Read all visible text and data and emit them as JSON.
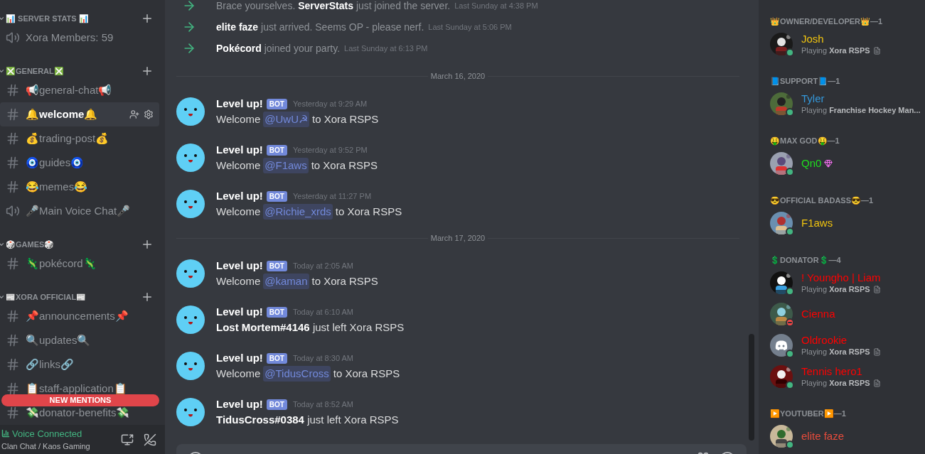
{
  "sidebar": {
    "categories": [
      {
        "name": "📊 SERVER STATS 📊",
        "channels": [
          {
            "kind": "voice",
            "name": "Xora Members: 59",
            "selected": false
          }
        ]
      },
      {
        "name": "❎GENERAL❎",
        "channels": [
          {
            "kind": "text",
            "name": "📢general-chat📢",
            "selected": false
          },
          {
            "kind": "text",
            "name": "🔔welcome🔔",
            "selected": true
          },
          {
            "kind": "text",
            "name": "💰trading-post💰",
            "selected": false
          },
          {
            "kind": "text",
            "name": "🧿guides🧿",
            "selected": false
          },
          {
            "kind": "text",
            "name": "😂memes😂",
            "selected": false
          },
          {
            "kind": "voice",
            "name": "🎤Main Voice Chat🎤",
            "selected": false
          }
        ]
      },
      {
        "name": "🎲GAMES🎲",
        "channels": [
          {
            "kind": "text",
            "name": "🦎pokécord🦎",
            "selected": false
          }
        ]
      },
      {
        "name": "📰XORA OFFICIAL📰",
        "channels": [
          {
            "kind": "text",
            "name": "📌announcements📌",
            "selected": false
          },
          {
            "kind": "text",
            "name": "🔍updates🔍",
            "selected": false
          },
          {
            "kind": "text",
            "name": "🔗links🔗",
            "selected": false
          },
          {
            "kind": "text",
            "name": "📋staff-application📋",
            "selected": false
          },
          {
            "kind": "text",
            "name": "💸donator-benefits💸",
            "selected": false
          }
        ]
      }
    ],
    "new_mentions": "NEW MENTIONS",
    "voice_panel": {
      "status": "Voice Connected",
      "channel": "Clan Chat / Kaos Gaming"
    }
  },
  "chat": {
    "items": [
      {
        "kind": "system",
        "text": "Brace yourselves. **ServerStats** just joined the server.",
        "time": "Last Sunday at 4:38 PM"
      },
      {
        "kind": "system",
        "text": "**elite faze** just arrived. Seems OP - please nerf.",
        "time": "Last Sunday at 5:06 PM"
      },
      {
        "kind": "system",
        "text": "**Pokécord** joined your party.",
        "time": "Last Sunday at 6:13 PM"
      },
      {
        "kind": "divider",
        "text": "March 16, 2020"
      },
      {
        "kind": "message",
        "author": "Level up!",
        "tag": "BOT",
        "time": "Yesterday at 9:29 AM",
        "before": "Welcome",
        "mention": "@UwU☭",
        "after": "to Xora RSPS"
      },
      {
        "kind": "message",
        "author": "Level up!",
        "tag": "BOT",
        "time": "Yesterday at 9:52 PM",
        "before": "Welcome",
        "mention": "@F1aws",
        "after": "to Xora RSPS"
      },
      {
        "kind": "message",
        "author": "Level up!",
        "tag": "BOT",
        "time": "Yesterday at 11:27 PM",
        "before": "Welcome",
        "mention": "@Richie_xrds",
        "after": "to Xora RSPS"
      },
      {
        "kind": "divider",
        "text": "March 17, 2020"
      },
      {
        "kind": "message",
        "author": "Level up!",
        "tag": "BOT",
        "time": "Today at 2:05 AM",
        "before": "Welcome",
        "mention": "@kaman",
        "after": "to Xora RSPS"
      },
      {
        "kind": "message",
        "author": "Level up!",
        "tag": "BOT",
        "time": "Today at 6:10 AM",
        "text": "**Lost Mortem#4146** just left Xora RSPS"
      },
      {
        "kind": "message",
        "author": "Level up!",
        "tag": "BOT",
        "time": "Today at 8:30 AM",
        "before": "Welcome",
        "mention": "@TidusCross",
        "after": "to Xora RSPS"
      },
      {
        "kind": "message",
        "author": "Level up!",
        "tag": "BOT",
        "time": "Today at 8:52 AM",
        "text": "**TidusCross#0384** just left Xora RSPS"
      }
    ]
  },
  "members": {
    "groups": [
      {
        "name": "👑OWNER/DEVELOPER👑—1",
        "members": [
          {
            "name": "Josh",
            "color": "#f1c40f",
            "dnd": false,
            "default_avatar": false,
            "activity": "Playing **Xora RSPS**",
            "presence_icon": true,
            "boosting": false
          }
        ]
      },
      {
        "name": "📘SUPPORT📘—1",
        "members": [
          {
            "name": "Tyler",
            "color": "#3498db",
            "dnd": false,
            "default_avatar": false,
            "activity": "Playing **Franchise Hockey Man...**",
            "presence_icon": false,
            "boosting": false
          }
        ]
      },
      {
        "name": "🤑MAX GOD🤑—1",
        "members": [
          {
            "name": "Qn0",
            "color": "#1fdf1f",
            "dnd": false,
            "default_avatar": false,
            "presence_icon": false,
            "boosting": true
          }
        ]
      },
      {
        "name": "😎OFFICIAL BADASS😎—1",
        "members": [
          {
            "name": "F1aws",
            "color": "#f1c40f",
            "dnd": false,
            "default_avatar": false,
            "presence_icon": false,
            "boosting": false
          }
        ]
      },
      {
        "name": "💲DONATOR💲—4",
        "members": [
          {
            "name": "! Youngho | Liam",
            "color": "#ff0000",
            "dnd": false,
            "default_avatar": false,
            "activity": "Playing **Xora RSPS**",
            "presence_icon": true,
            "boosting": false
          },
          {
            "name": "Cienna",
            "color": "#ff0000",
            "dnd": true,
            "default_avatar": false,
            "presence_icon": false,
            "boosting": false
          },
          {
            "name": "Oldrookie",
            "color": "#ff0000",
            "dnd": false,
            "default_avatar": true,
            "activity": "Playing **Xora RSPS**",
            "presence_icon": true,
            "boosting": false
          },
          {
            "name": "Tennis hero1",
            "color": "#ff0000",
            "dnd": false,
            "default_avatar": false,
            "activity": "Playing **Xora RSPS**",
            "presence_icon": true,
            "boosting": false
          }
        ]
      },
      {
        "name": "▶️YOUTUBER▶️—1",
        "members": [
          {
            "name": "elite faze",
            "color": "#e74c3c",
            "dnd": false,
            "default_avatar": false,
            "presence_icon": false,
            "boosting": false
          }
        ]
      }
    ]
  }
}
